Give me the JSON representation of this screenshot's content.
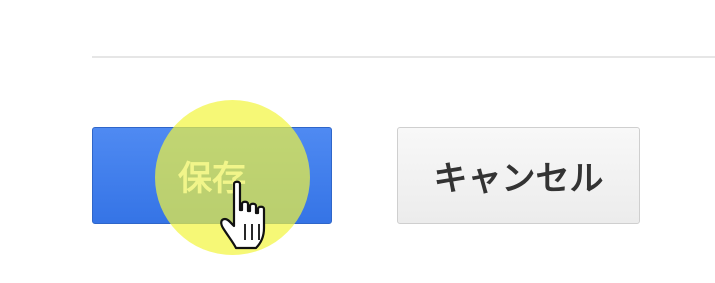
{
  "buttons": {
    "save_label": "保存",
    "cancel_label": "キャンセル"
  },
  "cursor": {
    "icon": "hand-pointer-icon"
  },
  "highlight": {
    "icon": "click-highlight",
    "color": "#f2f53c"
  },
  "colors": {
    "save_button": "#3574e6",
    "cancel_button": "#ececec"
  }
}
